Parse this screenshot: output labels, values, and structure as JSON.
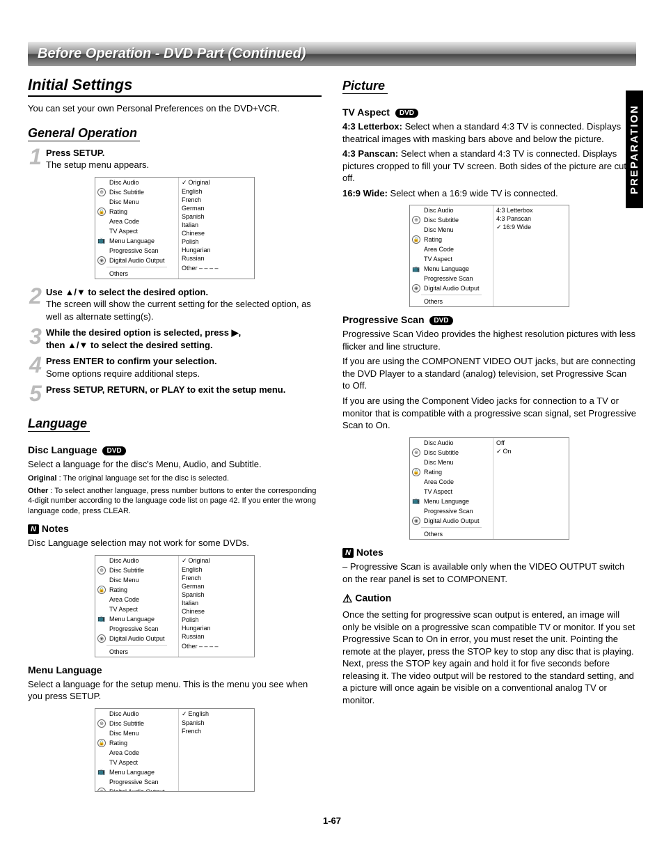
{
  "side_tab": "PREPARATION",
  "header_bar": "Before Operation - DVD Part (Continued)",
  "page_number": "1-67",
  "left": {
    "title": "Initial Settings",
    "intro": "You can set your own Personal Preferences on the DVD+VCR.",
    "general_heading": "General Operation",
    "steps": {
      "s1b": "Press SETUP.",
      "s1t": "The setup menu appears.",
      "s2b": "Use ▲/▼ to select the desired option.",
      "s2t": "The screen will show the current setting for the selected option, as well as alternate setting(s).",
      "s3b1": "While the desired option is selected, press ▶,",
      "s3b2": "then ▲/▼ to select the desired setting.",
      "s4b": "Press ENTER to confirm your selection.",
      "s4t": "Some options require additional steps.",
      "s5b": "Press SETUP, RETURN, or PLAY to exit the setup menu."
    },
    "language_heading": "Language",
    "disc_lang_heading": "Disc Language",
    "disc_lang_intro": "Select a language for the disc's Menu, Audio, and Subtitle.",
    "disc_lang_original_b": "Original",
    "disc_lang_original_t": " : The original language set for the disc is selected.",
    "disc_lang_other_b": "Other",
    "disc_lang_other_t": " : To select another language, press number buttons to enter the corresponding 4-digit number according to the language code list on page 42. If you enter the wrong language code, press CLEAR.",
    "notes_label": "Notes",
    "disc_lang_note": "Disc Language selection may not work for some DVDs.",
    "menu_lang_heading": "Menu Language",
    "menu_lang_text": "Select a language for the setup menu. This is the menu you see when you press SETUP."
  },
  "right": {
    "picture_heading": "Picture",
    "tv_aspect_heading": "TV Aspect",
    "aspect1b": "4:3 Letterbox:",
    "aspect1t": " Select when a standard 4:3 TV is connected. Displays theatrical images with masking bars above and below the picture.",
    "aspect2b": "4:3 Panscan:",
    "aspect2t": " Select when a standard 4:3 TV is connected. Displays pictures cropped to fill your TV screen. Both sides of the picture are cut off.",
    "aspect3b": "16:9 Wide:",
    "aspect3t": " Select when a 16:9 wide TV is connected.",
    "prog_heading": "Progressive Scan",
    "prog_p1": "Progressive Scan Video provides the highest resolution pictures with less flicker and line structure.",
    "prog_p2": "If you are using the COMPONENT VIDEO OUT jacks, but are connecting the DVD Player to a standard (analog) television, set Progressive Scan to Off.",
    "prog_p3": "If you are using the Component Video jacks for connection to a TV or monitor that is compatible with a progressive scan signal, set Progressive Scan to On.",
    "notes_label": "Notes",
    "prog_note": "– Progressive Scan is available only when the VIDEO OUTPUT switch on the rear panel is set to COMPONENT.",
    "caution_label": "Caution",
    "caution_text": "Once the setting for progressive scan output is entered, an image will only be visible on a progressive scan compatible TV or monitor. If you set Progressive Scan to On in error, you must reset the unit. Pointing the remote at the player, press the STOP key to stop any disc that is playing. Next, press the STOP key again and hold it for five seconds before releasing it. The video output will be restored to the standard setting, and a picture will once again be visible on a conventional analog TV or monitor."
  },
  "menu": {
    "left_items": [
      "Disc Audio",
      "Disc Subtitle",
      "Disc Menu",
      "Rating",
      "Area Code",
      "TV Aspect",
      "Menu Language",
      "Progressive Scan",
      "Digital Audio Output"
    ],
    "others": "Others",
    "other_code": "Other  – – – –",
    "lang_opts_sel": "Original",
    "lang_opts": [
      "English",
      "French",
      "German",
      "Spanish",
      "Italian",
      "Chinese",
      "Polish",
      "Hungarian",
      "Russian"
    ],
    "menu_lang_sel": "English",
    "menu_lang_opts": [
      "Spanish",
      "French"
    ],
    "aspect_opts": [
      "4:3 Letterbox",
      "4:3 Panscan"
    ],
    "aspect_sel": "16:9 Wide",
    "prog_opts": [
      "Off"
    ],
    "prog_sel": "On"
  },
  "dvd_badge": "DVD"
}
